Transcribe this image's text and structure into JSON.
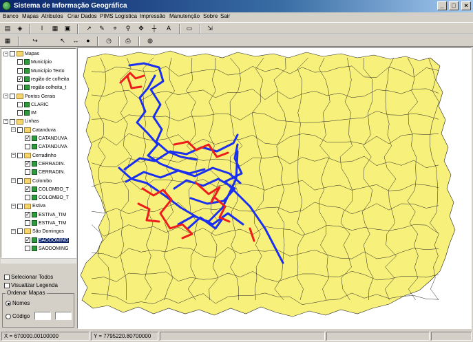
{
  "window": {
    "title": "Sistema de Informação Geográfica",
    "controls": [
      "_",
      "□",
      "×"
    ]
  },
  "menu": [
    "Banco",
    "Mapas",
    "Atributos",
    "Criar Dados",
    "PIMS",
    "Logística",
    "Impressão",
    "Manutenção",
    "Sobre",
    "Sair"
  ],
  "toolbar1": {
    "buttons": [
      {
        "name": "database-icon",
        "glyph": "▤"
      },
      {
        "name": "open-icon",
        "glyph": "◈"
      },
      {
        "name": "info-icon",
        "glyph": "I"
      },
      {
        "name": "table-icon",
        "glyph": "▦"
      },
      {
        "name": "save-icon",
        "glyph": "▣"
      },
      {
        "name": "draw-line-icon",
        "glyph": "↗"
      },
      {
        "name": "edit-icon",
        "glyph": "✎"
      },
      {
        "name": "select-icon",
        "glyph": "⌖"
      },
      {
        "name": "identify-icon",
        "glyph": "⚲"
      },
      {
        "name": "move-icon",
        "glyph": "✥"
      },
      {
        "name": "crosshair-icon",
        "glyph": "┼"
      },
      {
        "name": "label-icon",
        "glyph": "A"
      },
      {
        "name": "scale-icon",
        "glyph": "▭"
      },
      {
        "name": "export-icon",
        "glyph": "⇲"
      }
    ]
  },
  "toolbar2": {
    "buttons": [
      {
        "name": "grid-icon",
        "glyph": "▦"
      },
      {
        "name": "route-icon",
        "glyph": "↪"
      },
      {
        "name": "pointer-icon",
        "glyph": "↖"
      },
      {
        "name": "measure-icon",
        "glyph": "↔"
      },
      {
        "name": "locate-icon",
        "glyph": "●"
      },
      {
        "name": "clock-icon",
        "glyph": "◷"
      },
      {
        "name": "print-icon",
        "glyph": "⎙"
      },
      {
        "name": "globe-icon",
        "glyph": "◍"
      }
    ]
  },
  "layer_tree": [
    {
      "level": 0,
      "type": "group",
      "label": "Mapas",
      "checked": false
    },
    {
      "level": 1,
      "type": "layer",
      "label": "Município",
      "checked": false
    },
    {
      "level": 1,
      "type": "layer",
      "label": "Município Texto",
      "checked": false
    },
    {
      "level": 1,
      "type": "layer",
      "label": "região de colheita",
      "checked": true
    },
    {
      "level": 1,
      "type": "layer",
      "label": "região colheita_t",
      "checked": false
    },
    {
      "level": 0,
      "type": "group",
      "label": "Pontos Gerais",
      "checked": false
    },
    {
      "level": 1,
      "type": "layer",
      "label": "CLARIC",
      "checked": false
    },
    {
      "level": 1,
      "type": "layer",
      "label": "IM",
      "checked": false
    },
    {
      "level": 0,
      "type": "group",
      "label": "Linhas",
      "checked": false
    },
    {
      "level": 1,
      "type": "group",
      "label": "Catanduva",
      "checked": false
    },
    {
      "level": 2,
      "type": "layer",
      "label": "CATANDUVA",
      "checked": true
    },
    {
      "level": 2,
      "type": "layer",
      "label": "CATANDUVA",
      "checked": false
    },
    {
      "level": 1,
      "type": "group",
      "label": "Cerradinho",
      "checked": false
    },
    {
      "level": 2,
      "type": "layer",
      "label": "CERRADIN.",
      "checked": true
    },
    {
      "level": 2,
      "type": "layer",
      "label": "CERRADIN.",
      "checked": false
    },
    {
      "level": 1,
      "type": "group",
      "label": "Colombo",
      "checked": false
    },
    {
      "level": 2,
      "type": "layer",
      "label": "COLOMBO_T",
      "checked": true
    },
    {
      "level": 2,
      "type": "layer",
      "label": "COLOMBO_T",
      "checked": false
    },
    {
      "level": 1,
      "type": "group",
      "label": "Estiva",
      "checked": false
    },
    {
      "level": 2,
      "type": "layer",
      "label": "ESTIVA_TIM",
      "checked": true
    },
    {
      "level": 2,
      "type": "layer",
      "label": "ESTIVA_TIM",
      "checked": false
    },
    {
      "level": 1,
      "type": "group",
      "label": "São Domingos",
      "checked": false
    },
    {
      "level": 2,
      "type": "layer",
      "label": "SAODOMING",
      "checked": true,
      "selected": true
    },
    {
      "level": 2,
      "type": "layer",
      "label": "SAODOMING",
      "checked": false
    }
  ],
  "options": {
    "select_all": "Selecionar Todos",
    "show_legend": "Visualizar Legenda",
    "order_title": "Ordenar Mapas",
    "by_name": "Nomes",
    "by_code": "Código"
  },
  "status": {
    "x": "X = 670000.00100000",
    "y": "Y = 7795220.80700000"
  },
  "colors": {
    "map_fill": "#f7f07a",
    "route_blue": "#1a2ff0",
    "route_red": "#ee1c1c"
  }
}
